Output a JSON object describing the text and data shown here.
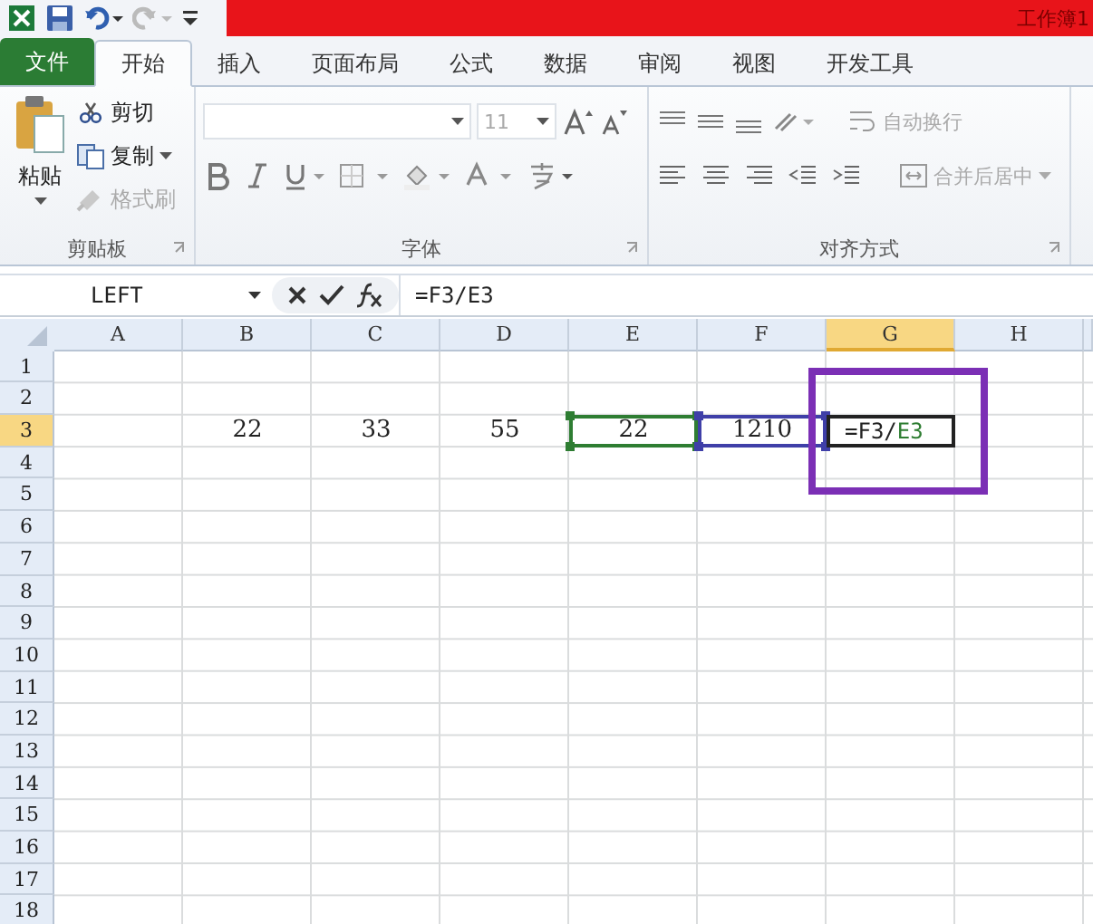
{
  "title_bar": {
    "title": "工作簿1"
  },
  "tabs": [
    {
      "label": "文件",
      "kind": "file",
      "selected": false
    },
    {
      "label": "开始",
      "kind": "tab",
      "selected": true
    },
    {
      "label": "插入",
      "kind": "tab",
      "selected": false
    },
    {
      "label": "页面布局",
      "kind": "tab",
      "selected": false
    },
    {
      "label": "公式",
      "kind": "tab",
      "selected": false
    },
    {
      "label": "数据",
      "kind": "tab",
      "selected": false
    },
    {
      "label": "审阅",
      "kind": "tab",
      "selected": false
    },
    {
      "label": "视图",
      "kind": "tab",
      "selected": false
    },
    {
      "label": "开发工具",
      "kind": "tab",
      "selected": false
    }
  ],
  "ribbon": {
    "clipboard": {
      "paste": "粘贴",
      "label": "剪贴板",
      "items": [
        {
          "label": "剪切",
          "kind": "cut",
          "disabled": false,
          "dropdown": false
        },
        {
          "label": "复制",
          "kind": "copy",
          "disabled": false,
          "dropdown": true
        },
        {
          "label": "格式刷",
          "kind": "painter",
          "disabled": true,
          "dropdown": false
        }
      ]
    },
    "font": {
      "size": "11",
      "label": "字体"
    },
    "alignment": {
      "wrap_text": "自动换行",
      "merge_center": "合并后居中",
      "label": "对齐方式"
    }
  },
  "formula_bar": {
    "name_box": "LEFT",
    "formula": "=F3/E3"
  },
  "sheet": {
    "columns": [
      {
        "label": "A",
        "selected": false
      },
      {
        "label": "B",
        "selected": false
      },
      {
        "label": "C",
        "selected": false
      },
      {
        "label": "D",
        "selected": false
      },
      {
        "label": "E",
        "selected": false
      },
      {
        "label": "F",
        "selected": false
      },
      {
        "label": "G",
        "selected": true
      },
      {
        "label": "H",
        "selected": false
      }
    ],
    "rows": [
      {
        "label": "1",
        "selected": false,
        "cells": []
      },
      {
        "label": "2",
        "selected": false,
        "cells": []
      },
      {
        "label": "3",
        "selected": true,
        "cells": [
          {},
          {
            "value": "22"
          },
          {
            "value": "33"
          },
          {
            "value": "55"
          },
          {
            "value": "22",
            "color": "#2e7d32"
          },
          {
            "value": "1210",
            "color": "#3f3fa8"
          },
          {
            "editing": true,
            "circled": true,
            "segments": [
              {
                "text": "=F3/"
              },
              {
                "text": "E3",
                "color": "#2e7d32"
              }
            ]
          },
          {}
        ]
      },
      {
        "label": "4",
        "selected": false,
        "cells": []
      },
      {
        "label": "5",
        "selected": false,
        "cells": []
      },
      {
        "label": "6",
        "selected": false,
        "cells": []
      },
      {
        "label": "7",
        "selected": false,
        "cells": []
      },
      {
        "label": "8",
        "selected": false,
        "cells": []
      },
      {
        "label": "9",
        "selected": false,
        "cells": []
      },
      {
        "label": "10",
        "selected": false,
        "cells": []
      },
      {
        "label": "11",
        "selected": false,
        "cells": []
      },
      {
        "label": "12",
        "selected": false,
        "cells": []
      },
      {
        "label": "13",
        "selected": false,
        "cells": []
      },
      {
        "label": "14",
        "selected": false,
        "cells": []
      },
      {
        "label": "15",
        "selected": false,
        "cells": []
      },
      {
        "label": "16",
        "selected": false,
        "cells": []
      },
      {
        "label": "17",
        "selected": false,
        "cells": []
      },
      {
        "label": "18",
        "selected": false,
        "cells": []
      }
    ]
  }
}
